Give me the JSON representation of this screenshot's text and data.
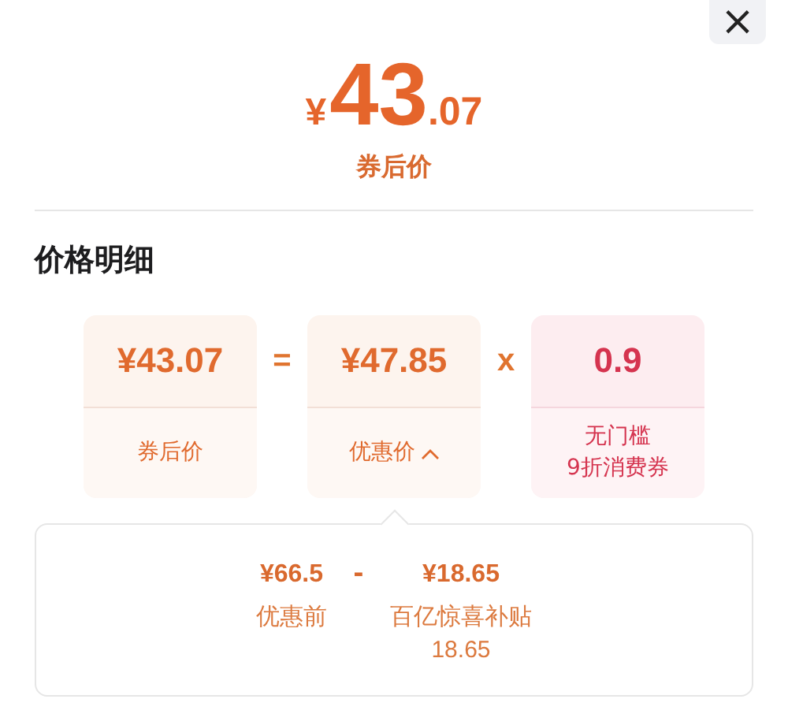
{
  "close_button": {
    "label": "×"
  },
  "price": {
    "currency": "¥",
    "integer": "43",
    "decimal": ".07",
    "label": "券后价"
  },
  "section_title": "价格明细",
  "formula": [
    {
      "kind": "price",
      "value": "¥43.07",
      "label": "券后价"
    },
    {
      "kind": "operator",
      "symbol": "="
    },
    {
      "kind": "price",
      "value": "¥47.85",
      "label": "优惠价",
      "expanded": true
    },
    {
      "kind": "operator",
      "symbol": "x"
    },
    {
      "kind": "coupon",
      "value": "0.9",
      "label_lines": [
        "无门槛",
        "9折消费券"
      ]
    }
  ],
  "breakdown": [
    {
      "kind": "amount",
      "value": "¥66.5",
      "label": "优惠前"
    },
    {
      "kind": "operator",
      "symbol": "-"
    },
    {
      "kind": "amount",
      "value": "¥18.65",
      "label": "百亿惊喜补贴",
      "note": "18.65"
    }
  ]
}
